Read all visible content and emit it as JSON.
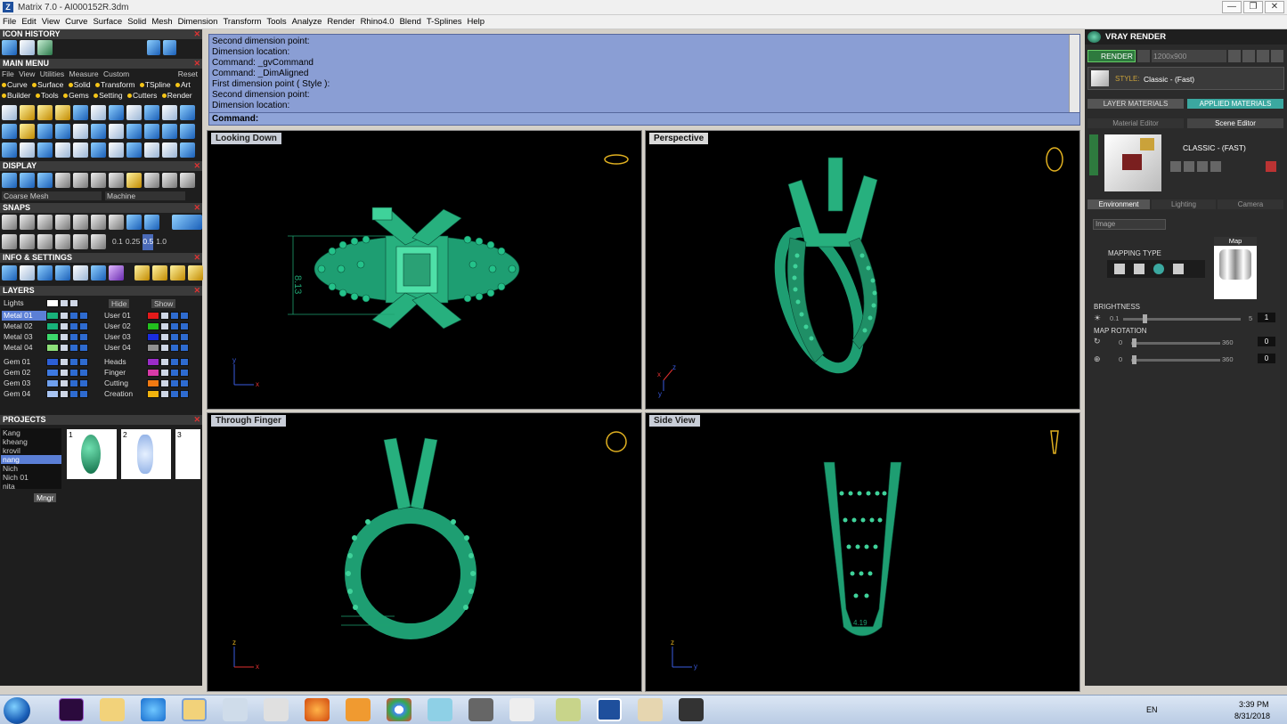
{
  "window": {
    "app_icon": "Z",
    "title": "Matrix 7.0 - AI000152R.3dm",
    "minimize": "—",
    "restore": "❐",
    "close": "✕"
  },
  "menu": [
    "File",
    "Edit",
    "View",
    "Curve",
    "Surface",
    "Solid",
    "Mesh",
    "Dimension",
    "Transform",
    "Tools",
    "Analyze",
    "Render",
    "Rhino4.0",
    "Blend",
    "T-Splines",
    "Help"
  ],
  "left": {
    "icon_history": "ICON HISTORY",
    "main_menu": "MAIN MENU",
    "main_menu_tabs": [
      "File",
      "View",
      "Utilities",
      "Measure",
      "Custom",
      "Reset"
    ],
    "main_menu_row1": [
      "Curve",
      "Surface",
      "Solid",
      "Transform",
      "TSpline",
      "Art"
    ],
    "main_menu_row2": [
      "Builder",
      "Tools",
      "Gems",
      "Setting",
      "Cutters",
      "Render"
    ],
    "display": "DISPLAY",
    "display_mesh": "Coarse Mesh",
    "display_mode": "Machine",
    "snaps": "SNAPS",
    "snap_values": [
      "0.1",
      "0.25",
      "0.5",
      "1.0"
    ],
    "info": "INFO & SETTINGS",
    "layers": "LAYERS",
    "lights": "Lights",
    "hide": "Hide",
    "show": "Show",
    "layer_col1": [
      "Metal 01",
      "Metal 02",
      "Metal 03",
      "Metal 04"
    ],
    "layer_col1_colors": [
      "#18b27a",
      "#18b27a",
      "#3dd86c",
      "#8ee07a"
    ],
    "layer_col2": [
      "User 01",
      "User 02",
      "User 03",
      "User 04"
    ],
    "layer_col2_colors": [
      "#e31a1a",
      "#22c01e",
      "#1a2de0",
      "#909090"
    ],
    "gem_col1": [
      "Gem 01",
      "Gem 02",
      "Gem 03",
      "Gem 04"
    ],
    "gem_col1_colors": [
      "#2c5fd6",
      "#3d79e0",
      "#6fa0ee",
      "#a8c4f2"
    ],
    "gem_col2": [
      "Heads",
      "Finger",
      "Cutting",
      "Creation"
    ],
    "gem_col2_colors": [
      "#9a2cc8",
      "#d83aa8",
      "#f07a12",
      "#f0b20e"
    ],
    "projects": "PROJECTS",
    "project_names": [
      "Kang",
      "kheang",
      "krovil",
      "nang",
      "Nich",
      "Nich 01",
      "nita"
    ],
    "project_thumbs": [
      "1",
      "2",
      "3"
    ],
    "mngr": "Mngr"
  },
  "console": {
    "lines": [
      "Second dimension point:",
      "Dimension location:",
      "Command: _gvCommand",
      "Command: _DimAligned",
      "First dimension point ( Style ):",
      "Second dimension point:",
      "Dimension location:"
    ],
    "prompt": "Command:"
  },
  "viewports": {
    "top_left": "Looking Down",
    "top_right": "Perspective",
    "bottom_left": "Through Finger",
    "bottom_right": "Side View",
    "dim_top": "8.13",
    "dim_side": "4.19"
  },
  "right": {
    "title": "VRAY RENDER",
    "render_btn": "RENDER",
    "resolution": "1200x900",
    "style_label": "STYLE:",
    "style_value": "Classic - (Fast)",
    "tab_layer": "LAYER MATERIALS",
    "tab_applied": "APPLIED MATERIALS",
    "tab_material_editor": "Material Editor",
    "tab_scene_editor": "Scene Editor",
    "scene_name": "CLASSIC - (FAST)",
    "sub_tabs": [
      "Environment",
      "Lighting",
      "Camera"
    ],
    "env_select": "Image",
    "map": "Map",
    "mapping_type": "MAPPING TYPE",
    "brightness": "BRIGHTNESS",
    "brightness_min": "0.1",
    "brightness_max": "5",
    "brightness_val": "1",
    "map_rotation": "MAP ROTATION",
    "rot_min": "0",
    "rot_max": "360",
    "rot1_val": "0",
    "rot2_val": "0"
  },
  "taskbar": {
    "lang": "EN",
    "time": "3:39 PM",
    "date": "8/31/2018"
  }
}
